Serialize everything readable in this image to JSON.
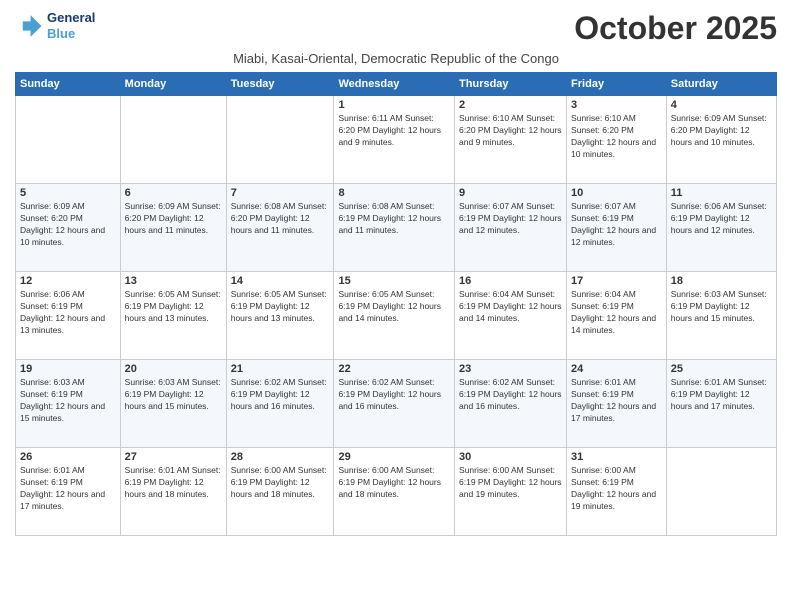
{
  "header": {
    "logo_line1": "General",
    "logo_line2": "Blue",
    "month": "October 2025",
    "location": "Miabi, Kasai-Oriental, Democratic Republic of the Congo"
  },
  "days_of_week": [
    "Sunday",
    "Monday",
    "Tuesday",
    "Wednesday",
    "Thursday",
    "Friday",
    "Saturday"
  ],
  "weeks": [
    [
      {
        "day": "",
        "content": ""
      },
      {
        "day": "",
        "content": ""
      },
      {
        "day": "",
        "content": ""
      },
      {
        "day": "1",
        "content": "Sunrise: 6:11 AM\nSunset: 6:20 PM\nDaylight: 12 hours\nand 9 minutes."
      },
      {
        "day": "2",
        "content": "Sunrise: 6:10 AM\nSunset: 6:20 PM\nDaylight: 12 hours\nand 9 minutes."
      },
      {
        "day": "3",
        "content": "Sunrise: 6:10 AM\nSunset: 6:20 PM\nDaylight: 12 hours\nand 10 minutes."
      },
      {
        "day": "4",
        "content": "Sunrise: 6:09 AM\nSunset: 6:20 PM\nDaylight: 12 hours\nand 10 minutes."
      }
    ],
    [
      {
        "day": "5",
        "content": "Sunrise: 6:09 AM\nSunset: 6:20 PM\nDaylight: 12 hours\nand 10 minutes."
      },
      {
        "day": "6",
        "content": "Sunrise: 6:09 AM\nSunset: 6:20 PM\nDaylight: 12 hours\nand 11 minutes."
      },
      {
        "day": "7",
        "content": "Sunrise: 6:08 AM\nSunset: 6:20 PM\nDaylight: 12 hours\nand 11 minutes."
      },
      {
        "day": "8",
        "content": "Sunrise: 6:08 AM\nSunset: 6:19 PM\nDaylight: 12 hours\nand 11 minutes."
      },
      {
        "day": "9",
        "content": "Sunrise: 6:07 AM\nSunset: 6:19 PM\nDaylight: 12 hours\nand 12 minutes."
      },
      {
        "day": "10",
        "content": "Sunrise: 6:07 AM\nSunset: 6:19 PM\nDaylight: 12 hours\nand 12 minutes."
      },
      {
        "day": "11",
        "content": "Sunrise: 6:06 AM\nSunset: 6:19 PM\nDaylight: 12 hours\nand 12 minutes."
      }
    ],
    [
      {
        "day": "12",
        "content": "Sunrise: 6:06 AM\nSunset: 6:19 PM\nDaylight: 12 hours\nand 13 minutes."
      },
      {
        "day": "13",
        "content": "Sunrise: 6:05 AM\nSunset: 6:19 PM\nDaylight: 12 hours\nand 13 minutes."
      },
      {
        "day": "14",
        "content": "Sunrise: 6:05 AM\nSunset: 6:19 PM\nDaylight: 12 hours\nand 13 minutes."
      },
      {
        "day": "15",
        "content": "Sunrise: 6:05 AM\nSunset: 6:19 PM\nDaylight: 12 hours\nand 14 minutes."
      },
      {
        "day": "16",
        "content": "Sunrise: 6:04 AM\nSunset: 6:19 PM\nDaylight: 12 hours\nand 14 minutes."
      },
      {
        "day": "17",
        "content": "Sunrise: 6:04 AM\nSunset: 6:19 PM\nDaylight: 12 hours\nand 14 minutes."
      },
      {
        "day": "18",
        "content": "Sunrise: 6:03 AM\nSunset: 6:19 PM\nDaylight: 12 hours\nand 15 minutes."
      }
    ],
    [
      {
        "day": "19",
        "content": "Sunrise: 6:03 AM\nSunset: 6:19 PM\nDaylight: 12 hours\nand 15 minutes."
      },
      {
        "day": "20",
        "content": "Sunrise: 6:03 AM\nSunset: 6:19 PM\nDaylight: 12 hours\nand 15 minutes."
      },
      {
        "day": "21",
        "content": "Sunrise: 6:02 AM\nSunset: 6:19 PM\nDaylight: 12 hours\nand 16 minutes."
      },
      {
        "day": "22",
        "content": "Sunrise: 6:02 AM\nSunset: 6:19 PM\nDaylight: 12 hours\nand 16 minutes."
      },
      {
        "day": "23",
        "content": "Sunrise: 6:02 AM\nSunset: 6:19 PM\nDaylight: 12 hours\nand 16 minutes."
      },
      {
        "day": "24",
        "content": "Sunrise: 6:01 AM\nSunset: 6:19 PM\nDaylight: 12 hours\nand 17 minutes."
      },
      {
        "day": "25",
        "content": "Sunrise: 6:01 AM\nSunset: 6:19 PM\nDaylight: 12 hours\nand 17 minutes."
      }
    ],
    [
      {
        "day": "26",
        "content": "Sunrise: 6:01 AM\nSunset: 6:19 PM\nDaylight: 12 hours\nand 17 minutes."
      },
      {
        "day": "27",
        "content": "Sunrise: 6:01 AM\nSunset: 6:19 PM\nDaylight: 12 hours\nand 18 minutes."
      },
      {
        "day": "28",
        "content": "Sunrise: 6:00 AM\nSunset: 6:19 PM\nDaylight: 12 hours\nand 18 minutes."
      },
      {
        "day": "29",
        "content": "Sunrise: 6:00 AM\nSunset: 6:19 PM\nDaylight: 12 hours\nand 18 minutes."
      },
      {
        "day": "30",
        "content": "Sunrise: 6:00 AM\nSunset: 6:19 PM\nDaylight: 12 hours\nand 19 minutes."
      },
      {
        "day": "31",
        "content": "Sunrise: 6:00 AM\nSunset: 6:19 PM\nDaylight: 12 hours\nand 19 minutes."
      },
      {
        "day": "",
        "content": ""
      }
    ]
  ]
}
